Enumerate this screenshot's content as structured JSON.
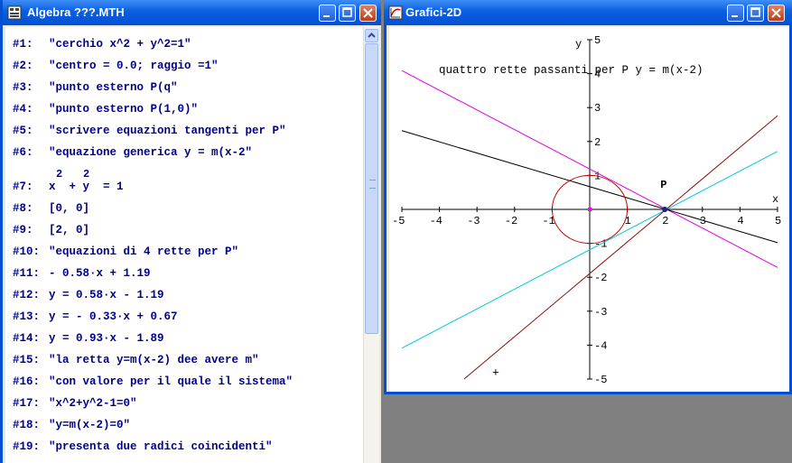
{
  "algebra_window": {
    "title": "Algebra  ???.MTH",
    "lines": [
      {
        "label": "#1:",
        "text": "\"cerchio x^2 + y^2=1\""
      },
      {
        "label": "#2:",
        "text": "\"centro = 0.0; raggio =1\""
      },
      {
        "label": "#3:",
        "text": "\"punto esterno P(q\""
      },
      {
        "label": "#4:",
        "text": "\"punto esterno P(1,0)\""
      },
      {
        "label": "#5:",
        "text": "\"scrivere equazioni tangenti per P\""
      },
      {
        "label": "#6:",
        "text": "\"equazione generica y = m(x-2\""
      },
      {
        "label": "#7:",
        "text": "x  + y  = 1",
        "superscripts": [
          "2",
          "2"
        ]
      },
      {
        "label": "#8:",
        "text": "[0, 0]"
      },
      {
        "label": "#9:",
        "text": "[2, 0]"
      },
      {
        "label": "#10:",
        "text": "\"equazioni di 4 rette per P\""
      },
      {
        "label": "#11:",
        "text": "- 0.58·x + 1.19"
      },
      {
        "label": "#12:",
        "text": "y = 0.58·x - 1.19"
      },
      {
        "label": "#13:",
        "text": "y = - 0.33·x + 0.67"
      },
      {
        "label": "#14:",
        "text": "y = 0.93·x - 1.89"
      },
      {
        "label": "#15:",
        "text": "\"la retta y=m(x-2) dee avere m\""
      },
      {
        "label": "#16:",
        "text": "\"con valore per il quale il sistema\""
      },
      {
        "label": "#17:",
        "text": "\"x^2+y^2-1=0\""
      },
      {
        "label": "#18:",
        "text": "\"y=m(x-2)=0\""
      },
      {
        "label": "#19:",
        "text": "\"presenta due radici coincidenti\""
      }
    ]
  },
  "grafici_window": {
    "title": "Grafici-2D",
    "plot": {
      "annotation": "quattro rette passanti per P y = m(x-2)",
      "x_label": "x",
      "y_label": "y",
      "point_label": "P",
      "cursor_glyph": "+",
      "x_range": [
        -5,
        5
      ],
      "y_range": [
        -5,
        5
      ],
      "x_ticks": [
        "-5",
        "-4",
        "-3",
        "-2",
        "-1",
        "1",
        "2",
        "3",
        "4",
        "5"
      ],
      "y_ticks": [
        "5",
        "4",
        "3",
        "2",
        "1",
        "-1",
        "-2",
        "-3",
        "-4",
        "-5"
      ],
      "circle": {
        "cx": 0,
        "cy": 0,
        "r": 1,
        "color": "#c00000"
      },
      "center_point": {
        "x": 0,
        "y": 0,
        "color": "#ff00ff"
      },
      "point_P": {
        "x": 2,
        "y": 0,
        "color": "#1a237e"
      },
      "lines": [
        {
          "m": -0.58,
          "b": 1.19,
          "color": "#e000e0"
        },
        {
          "m": 0.58,
          "b": -1.19,
          "color": "#00c8e0"
        },
        {
          "m": -0.33,
          "b": 0.67,
          "color": "#000000"
        },
        {
          "m": 0.93,
          "b": -1.89,
          "color": "#8b1010"
        }
      ],
      "cursor_position": {
        "x": -2.5,
        "y": -4.8
      }
    }
  }
}
